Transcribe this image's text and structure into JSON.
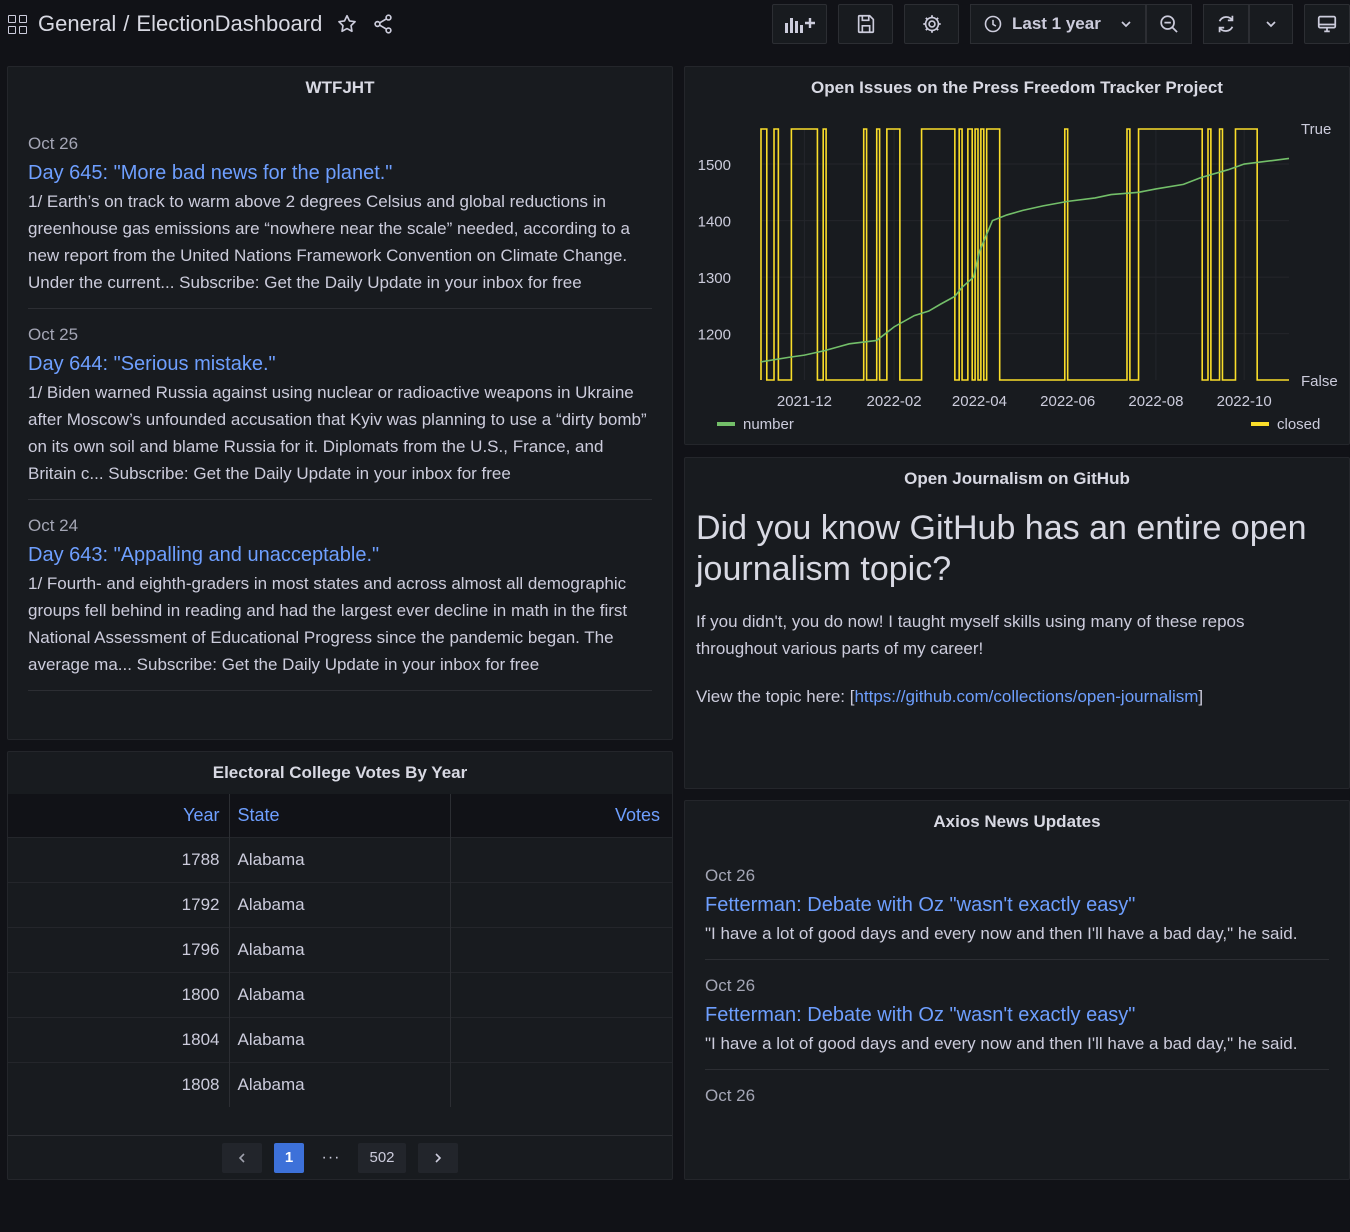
{
  "nav": {
    "folder": "General",
    "separator": "/",
    "dashboard": "ElectionDashboard",
    "time_range": "Last 1 year"
  },
  "wtf": {
    "title": "WTFJHT",
    "items": [
      {
        "date": "Oct 26",
        "title": "Day 645: \"More bad news for the planet.\"",
        "body": "1/ Earth’s on track to warm above 2 degrees Celsius and global reductions in greenhouse gas emissions are “nowhere near the scale” needed, according to a new report from the United Nations Framework Convention on Climate Change. Under the current... Subscribe: Get the Daily Update in your inbox for free"
      },
      {
        "date": "Oct 25",
        "title": "Day 644: \"Serious mistake.\"",
        "body": "1/ Biden warned Russia against using nuclear or radioactive weapons in Ukraine after Moscow’s unfounded accusation that Kyiv was planning to use a “dirty bomb” on its own soil and blame Russia for it. Diplomats from the U.S., France, and Britain c... Subscribe: Get the Daily Update in your inbox for free"
      },
      {
        "date": "Oct 24",
        "title": "Day 643: \"Appalling and unacceptable.\"",
        "body": "1/ Fourth- and eighth-graders in most states and across almost all demographic groups fell behind in reading and had the largest ever decline in math in the first National Assessment of Educational Progress since the pandemic began. The average ma... Subscribe: Get the Daily Update in your inbox for free"
      }
    ]
  },
  "press": {
    "title": "Open Issues on the Press Freedom Tracker Project",
    "legend_number": "number",
    "legend_closed": "closed"
  },
  "chart_data": {
    "type": "line",
    "x_ticks": [
      "2021-12",
      "2022-02",
      "2022-04",
      "2022-06",
      "2022-08",
      "2022-10"
    ],
    "y_ticks": [
      1200,
      1300,
      1400,
      1500
    ],
    "right_ticks": [
      "True",
      "False"
    ],
    "colors": {
      "number": "#73bf69",
      "closed": "#fade2a"
    },
    "series": [
      {
        "name": "number",
        "axis": "left",
        "x": [
          "2021-11-01",
          "2021-11-20",
          "2021-12-01",
          "2021-12-15",
          "2021-12-25",
          "2022-01-01",
          "2022-01-20",
          "2022-02-01",
          "2022-02-15",
          "2022-02-25",
          "2022-03-05",
          "2022-03-15",
          "2022-03-20",
          "2022-03-28",
          "2022-04-01",
          "2022-04-10",
          "2022-04-20",
          "2022-05-01",
          "2022-05-15",
          "2022-06-01",
          "2022-06-20",
          "2022-07-01",
          "2022-07-20",
          "2022-08-01",
          "2022-08-20",
          "2022-09-01",
          "2022-09-20",
          "2022-10-01",
          "2022-10-20",
          "2022-11-01"
        ],
        "values": [
          1150,
          1158,
          1162,
          1170,
          1177,
          1182,
          1188,
          1212,
          1232,
          1240,
          1252,
          1266,
          1282,
          1300,
          1345,
          1400,
          1410,
          1418,
          1426,
          1434,
          1440,
          1446,
          1450,
          1456,
          1464,
          1476,
          1490,
          1500,
          1506,
          1510
        ]
      },
      {
        "name": "closed",
        "axis": "right",
        "pulses": [
          [
            "2021-11-01",
            "2021-11-05"
          ],
          [
            "2021-11-10",
            "2021-11-13"
          ],
          [
            "2021-11-22",
            "2021-12-10"
          ],
          [
            "2021-12-14",
            "2021-12-16"
          ],
          [
            "2022-01-11",
            "2022-01-13"
          ],
          [
            "2022-01-20",
            "2022-01-22"
          ],
          [
            "2022-01-27",
            "2022-02-05"
          ],
          [
            "2022-02-20",
            "2022-03-15"
          ],
          [
            "2022-03-18",
            "2022-03-20"
          ],
          [
            "2022-03-24",
            "2022-03-27"
          ],
          [
            "2022-03-29",
            "2022-03-31"
          ],
          [
            "2022-04-02",
            "2022-04-04"
          ],
          [
            "2022-04-06",
            "2022-04-15"
          ],
          [
            "2022-05-30",
            "2022-06-01"
          ],
          [
            "2022-07-12",
            "2022-07-14"
          ],
          [
            "2022-07-20",
            "2022-09-02"
          ],
          [
            "2022-09-06",
            "2022-09-08"
          ],
          [
            "2022-09-14",
            "2022-09-16"
          ],
          [
            "2022-09-25",
            "2022-10-10"
          ]
        ]
      }
    ]
  },
  "github": {
    "title": "Open Journalism on GitHub",
    "heading": "Did you know GitHub has an entire open journalism topic?",
    "para": "If you didn't, you do now! I taught myself skills using many of these repos throughout various parts of my career!",
    "view_prefix": "View the topic here: [",
    "view_link": "https://github.com/collections/open-journalism",
    "view_suffix": "]"
  },
  "electoral": {
    "title": "Electoral College Votes By Year",
    "columns": {
      "year": "Year",
      "state": "State",
      "votes": "Votes"
    },
    "rows": [
      {
        "year": "1788",
        "state": "Alabama",
        "votes": ""
      },
      {
        "year": "1792",
        "state": "Alabama",
        "votes": ""
      },
      {
        "year": "1796",
        "state": "Alabama",
        "votes": ""
      },
      {
        "year": "1800",
        "state": "Alabama",
        "votes": ""
      },
      {
        "year": "1804",
        "state": "Alabama",
        "votes": ""
      },
      {
        "year": "1808",
        "state": "Alabama",
        "votes": ""
      }
    ],
    "pager": {
      "current": "1",
      "dots": "···",
      "last": "502"
    }
  },
  "axios": {
    "title": "Axios News Updates",
    "items": [
      {
        "date": "Oct 26",
        "title": "Fetterman: Debate with Oz \"wasn't exactly easy\"",
        "body": "\"I have a lot of good days and every now and then I'll have a bad day,\" he said."
      },
      {
        "date": "Oct 26",
        "title": "Fetterman: Debate with Oz \"wasn't exactly easy\"",
        "body": "\"I have a lot of good days and every now and then I'll have a bad day,\" he said."
      },
      {
        "date": "Oct 26",
        "title": "",
        "body": ""
      }
    ]
  }
}
